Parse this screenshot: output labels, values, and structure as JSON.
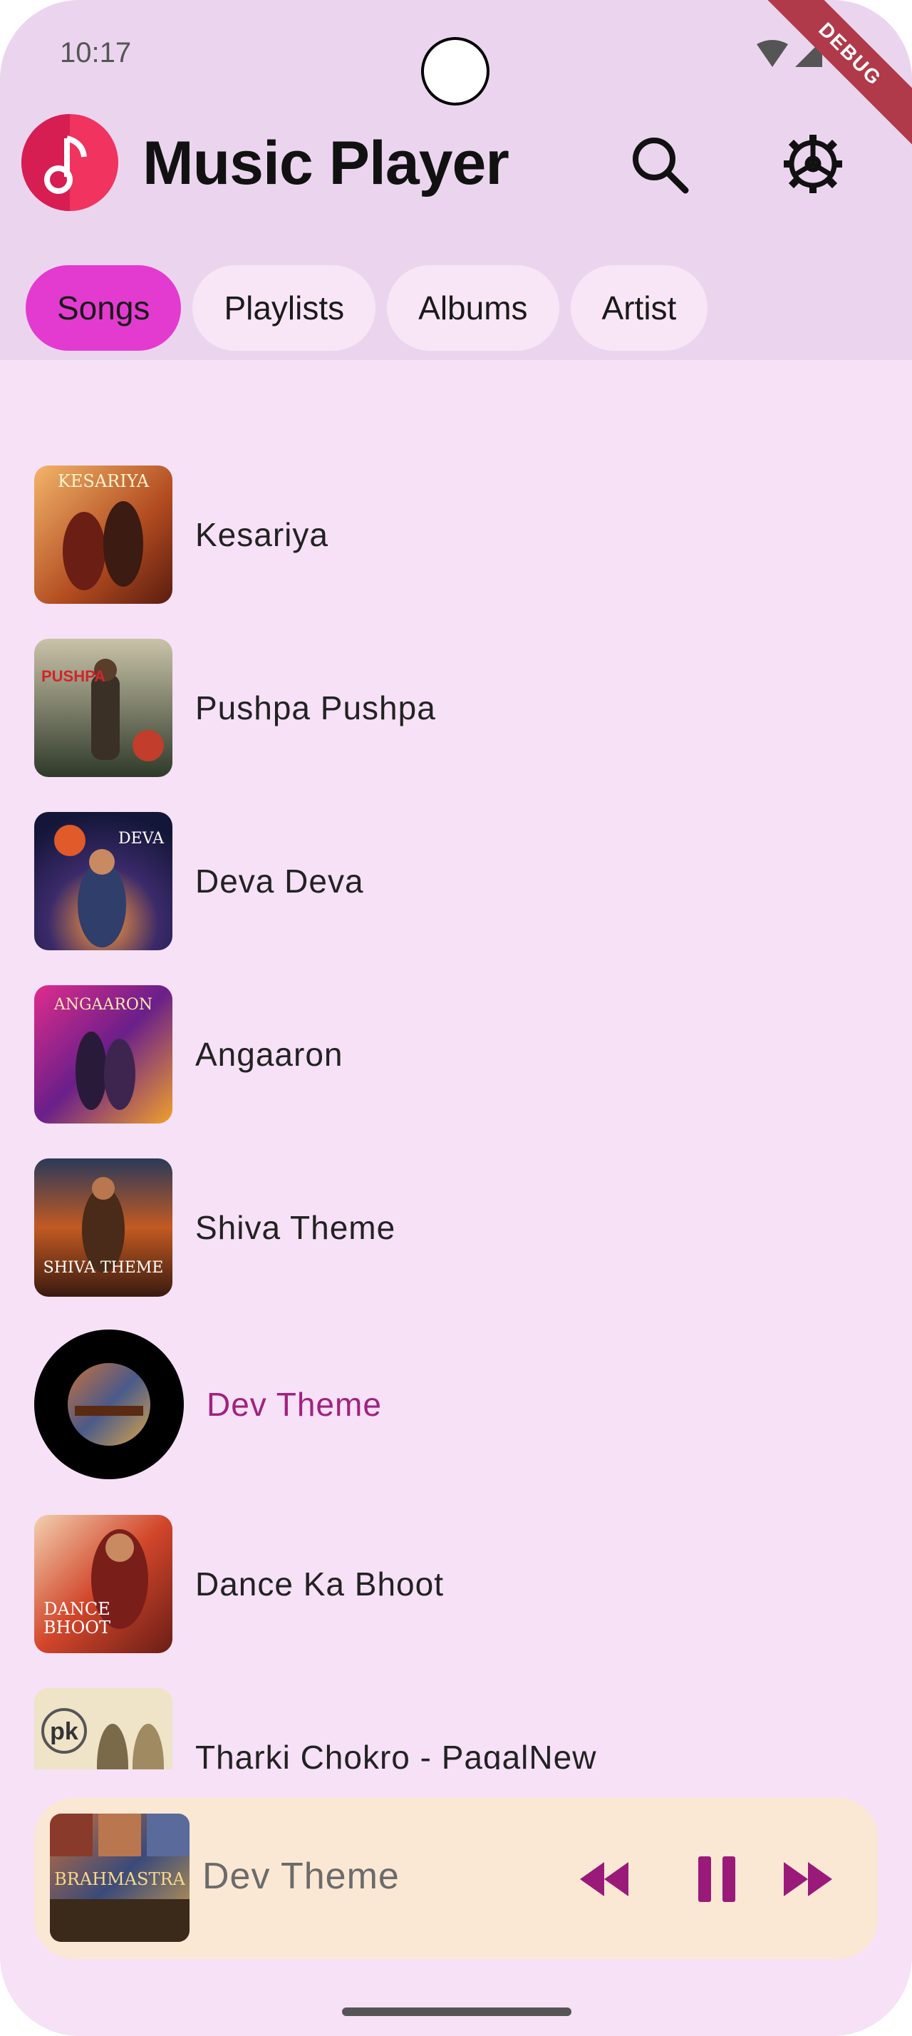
{
  "status_bar": {
    "time": "10:17",
    "debug_label": "DEBUG"
  },
  "app": {
    "title": "Music Player",
    "accent": "#e33bd0",
    "playing_color": "#a0227f"
  },
  "tabs": [
    {
      "label": "Songs",
      "active": true
    },
    {
      "label": "Playlists",
      "active": false
    },
    {
      "label": "Albums",
      "active": false
    },
    {
      "label": "Artist",
      "active": false
    }
  ],
  "songs": [
    {
      "title": "Kesariya",
      "art_text": "KESARIYA"
    },
    {
      "title": "Pushpa Pushpa",
      "art_text": "PUSHPA PUSHPA"
    },
    {
      "title": "Deva Deva",
      "art_text": "DEVA DEVA"
    },
    {
      "title": "Angaaron",
      "art_text": "ANGAARON"
    },
    {
      "title": "Shiva Theme",
      "art_text": "SHIVA THEME"
    },
    {
      "title": "Dev Theme",
      "art_text": "BRAHMASTRA",
      "playing": true
    },
    {
      "title": "Dance Ka Bhoot",
      "art_text": "DANCE KA BHOOT"
    },
    {
      "title": "Tharki Chokro - PagalNew",
      "art_text": "pk"
    }
  ],
  "mini_player": {
    "title": "Dev Theme",
    "art_text": "BRAHMASTRA",
    "state": "playing"
  }
}
